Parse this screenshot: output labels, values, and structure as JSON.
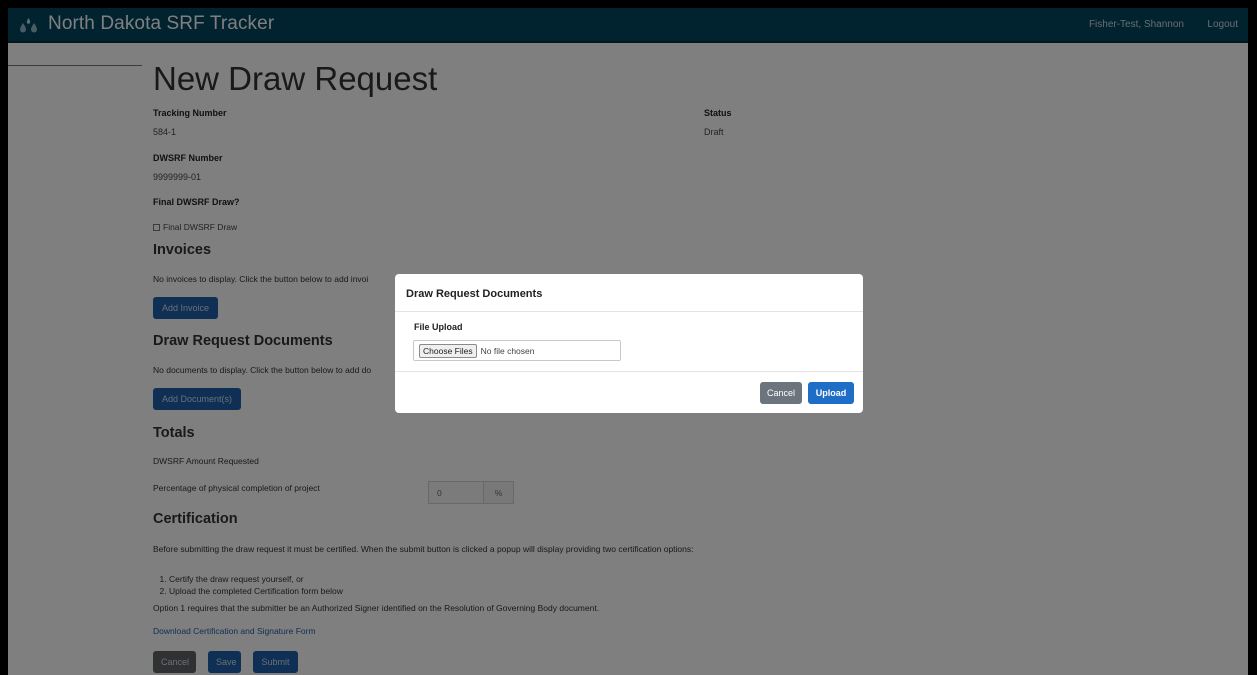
{
  "app": {
    "title": "North Dakota SRF Tracker",
    "icon": "water-drops-icon"
  },
  "nav": {
    "user": "Fisher-Test, Shannon",
    "logout": "Logout"
  },
  "page": {
    "title": "New Draw Request"
  },
  "fields": {
    "tracking_label": "Tracking Number",
    "tracking_value": "584-1",
    "status_label": "Status",
    "status_value": "Draft",
    "dwsrf_label": "DWSRF Number",
    "dwsrf_value": "9999999-01",
    "final_label": "Final DWSRF Draw?",
    "final_checkbox": "Final DWSRF Draw"
  },
  "invoices": {
    "heading": "Invoices",
    "empty_text": "No invoices to display. Click the button below to add invoi",
    "add_button": "Add Invoice"
  },
  "documents": {
    "heading": "Draw Request Documents",
    "empty_text": "No documents to display. Click the button below to add do",
    "add_button": "Add Document(s)"
  },
  "totals": {
    "heading": "Totals",
    "amount_label": "DWSRF Amount Requested",
    "completion_label": "Percentage of physical completion of project",
    "completion_value": "0",
    "completion_unit": "%"
  },
  "certification": {
    "heading": "Certification",
    "intro": "Before submitting the draw request it must be certified. When the submit button is clicked a popup will display providing two certification options:",
    "options": [
      "Certify the draw request yourself, or",
      "Upload the completed Certification form below"
    ],
    "note": "Option 1 requires that the submitter be an Authorized Signer identified on the Resolution of Governing Body document.",
    "download_link": "Download Certification and Signature Form"
  },
  "actions": {
    "cancel": "Cancel",
    "save": "Save",
    "submit": "Submit"
  },
  "modal": {
    "title": "Draw Request Documents",
    "file_label": "File Upload",
    "choose_button": "Choose Files",
    "no_file": "No file chosen",
    "cancel": "Cancel",
    "upload": "Upload"
  },
  "colors": {
    "navbar": "#00465f",
    "primary": "#1f5fa8",
    "secondary": "#6c757d"
  }
}
